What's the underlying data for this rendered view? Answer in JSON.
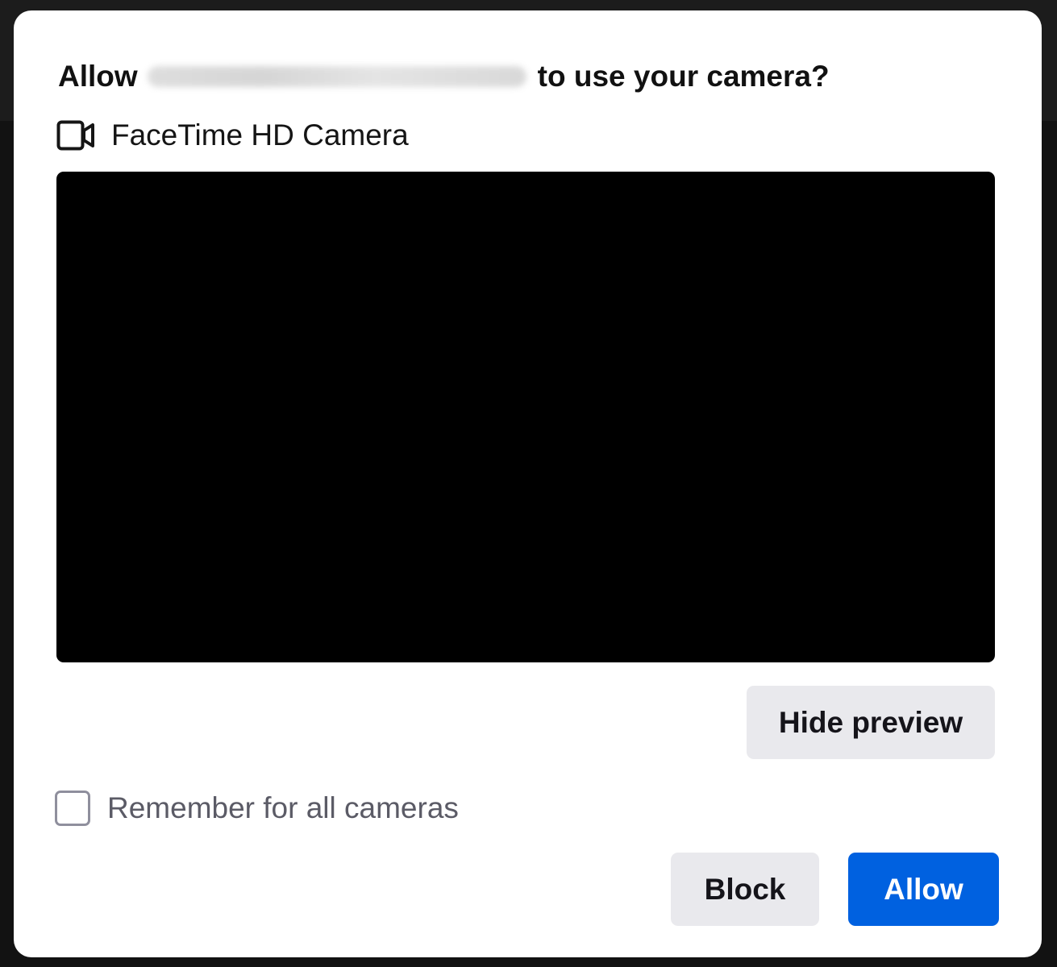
{
  "dialog": {
    "title_prefix": "Allow",
    "title_suffix": "to use your camera?",
    "camera": {
      "icon": "video-camera-icon",
      "name": "FaceTime HD Camera"
    },
    "preview": {
      "background": "#000000"
    },
    "hide_preview_label": "Hide preview",
    "remember_label": "Remember for all cameras",
    "remember_checked": false,
    "block_label": "Block",
    "allow_label": "Allow"
  },
  "colors": {
    "primary": "#0061e0",
    "secondary": "#e9e9ed",
    "dialog_background": "#ffffff",
    "backdrop": "#121212"
  }
}
